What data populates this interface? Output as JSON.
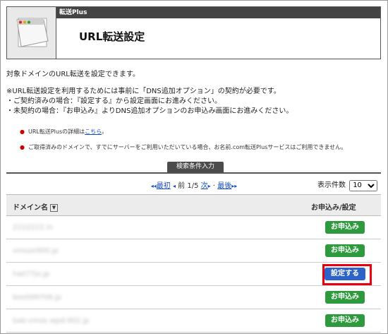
{
  "header": {
    "brand": "転送Plus",
    "title": "URL転送設定"
  },
  "intro": "対象ドメインのURL転送を設定できます。",
  "notes": [
    "※URL転送設定を利用するためには事前に「DNS追加オプション」の契約が必要です。",
    "・ご契約済みの場合：『設定する』から設定画面にお進みください。",
    "・未契約の場合：『お申込み』よりDNS追加オプションのお申込み画面にお進みください。"
  ],
  "bullets": [
    {
      "text": "URL転送Plusの詳細は",
      "link": "こちら",
      "suffix": "。"
    },
    {
      "text": "ご取得済みのドメインで、すでにサーバーをご利用いただいている場合、お名前.com転送Plusサービスはご利用できません。"
    }
  ],
  "search_tab": "検索条件入力",
  "pager": {
    "first": "最初",
    "prev": "前",
    "page": "1/5",
    "next": "次",
    "last": "最後"
  },
  "perpage": {
    "label": "表示件数",
    "value": "10"
  },
  "table": {
    "col_domain": "ドメイン名",
    "col_action": "お申込み/設定",
    "rows": [
      {
        "domain": "2222222.in",
        "action": "お申込み",
        "type": "apply"
      },
      {
        "domain": "vmoze900.jp",
        "action": "お申込み",
        "type": "apply"
      },
      {
        "domain": "hwt77jo.jp",
        "action": "設定する",
        "type": "setting"
      },
      {
        "domain": "bee099708.jp",
        "action": "お申込み",
        "type": "apply"
      },
      {
        "domain": "bab-vmox.wpd-902.jp",
        "action": "お申込み",
        "type": "apply"
      }
    ]
  },
  "colors": {
    "apply": "#2e9a3e",
    "setting": "#2d63c8",
    "highlight": "#e8000e"
  }
}
